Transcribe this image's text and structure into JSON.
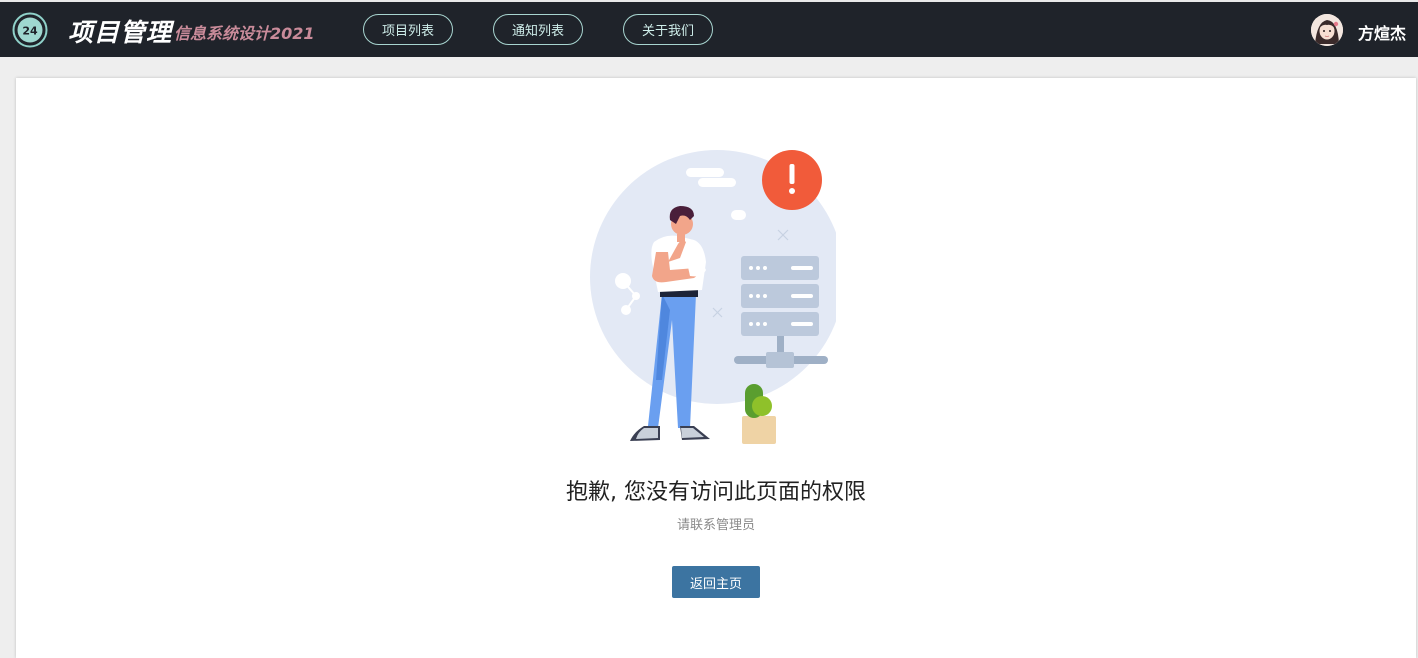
{
  "header": {
    "brand_title": "项目管理",
    "brand_subtitle": "信息系统设计2021",
    "logo_text": "24",
    "nav": [
      {
        "label": "项目列表"
      },
      {
        "label": "通知列表"
      },
      {
        "label": "关于我们"
      }
    ],
    "user_name": "方煊杰"
  },
  "main": {
    "title": "抱歉, 您没有访问此页面的权限",
    "subtitle": "请联系管理员",
    "home_button": "返回主页"
  },
  "colors": {
    "navbar": "#1f232a",
    "accent_border": "#a8d5d0",
    "subtitle_pink": "#c98b9a",
    "button_blue": "#3c74a1",
    "alert_red": "#f15b3a"
  }
}
